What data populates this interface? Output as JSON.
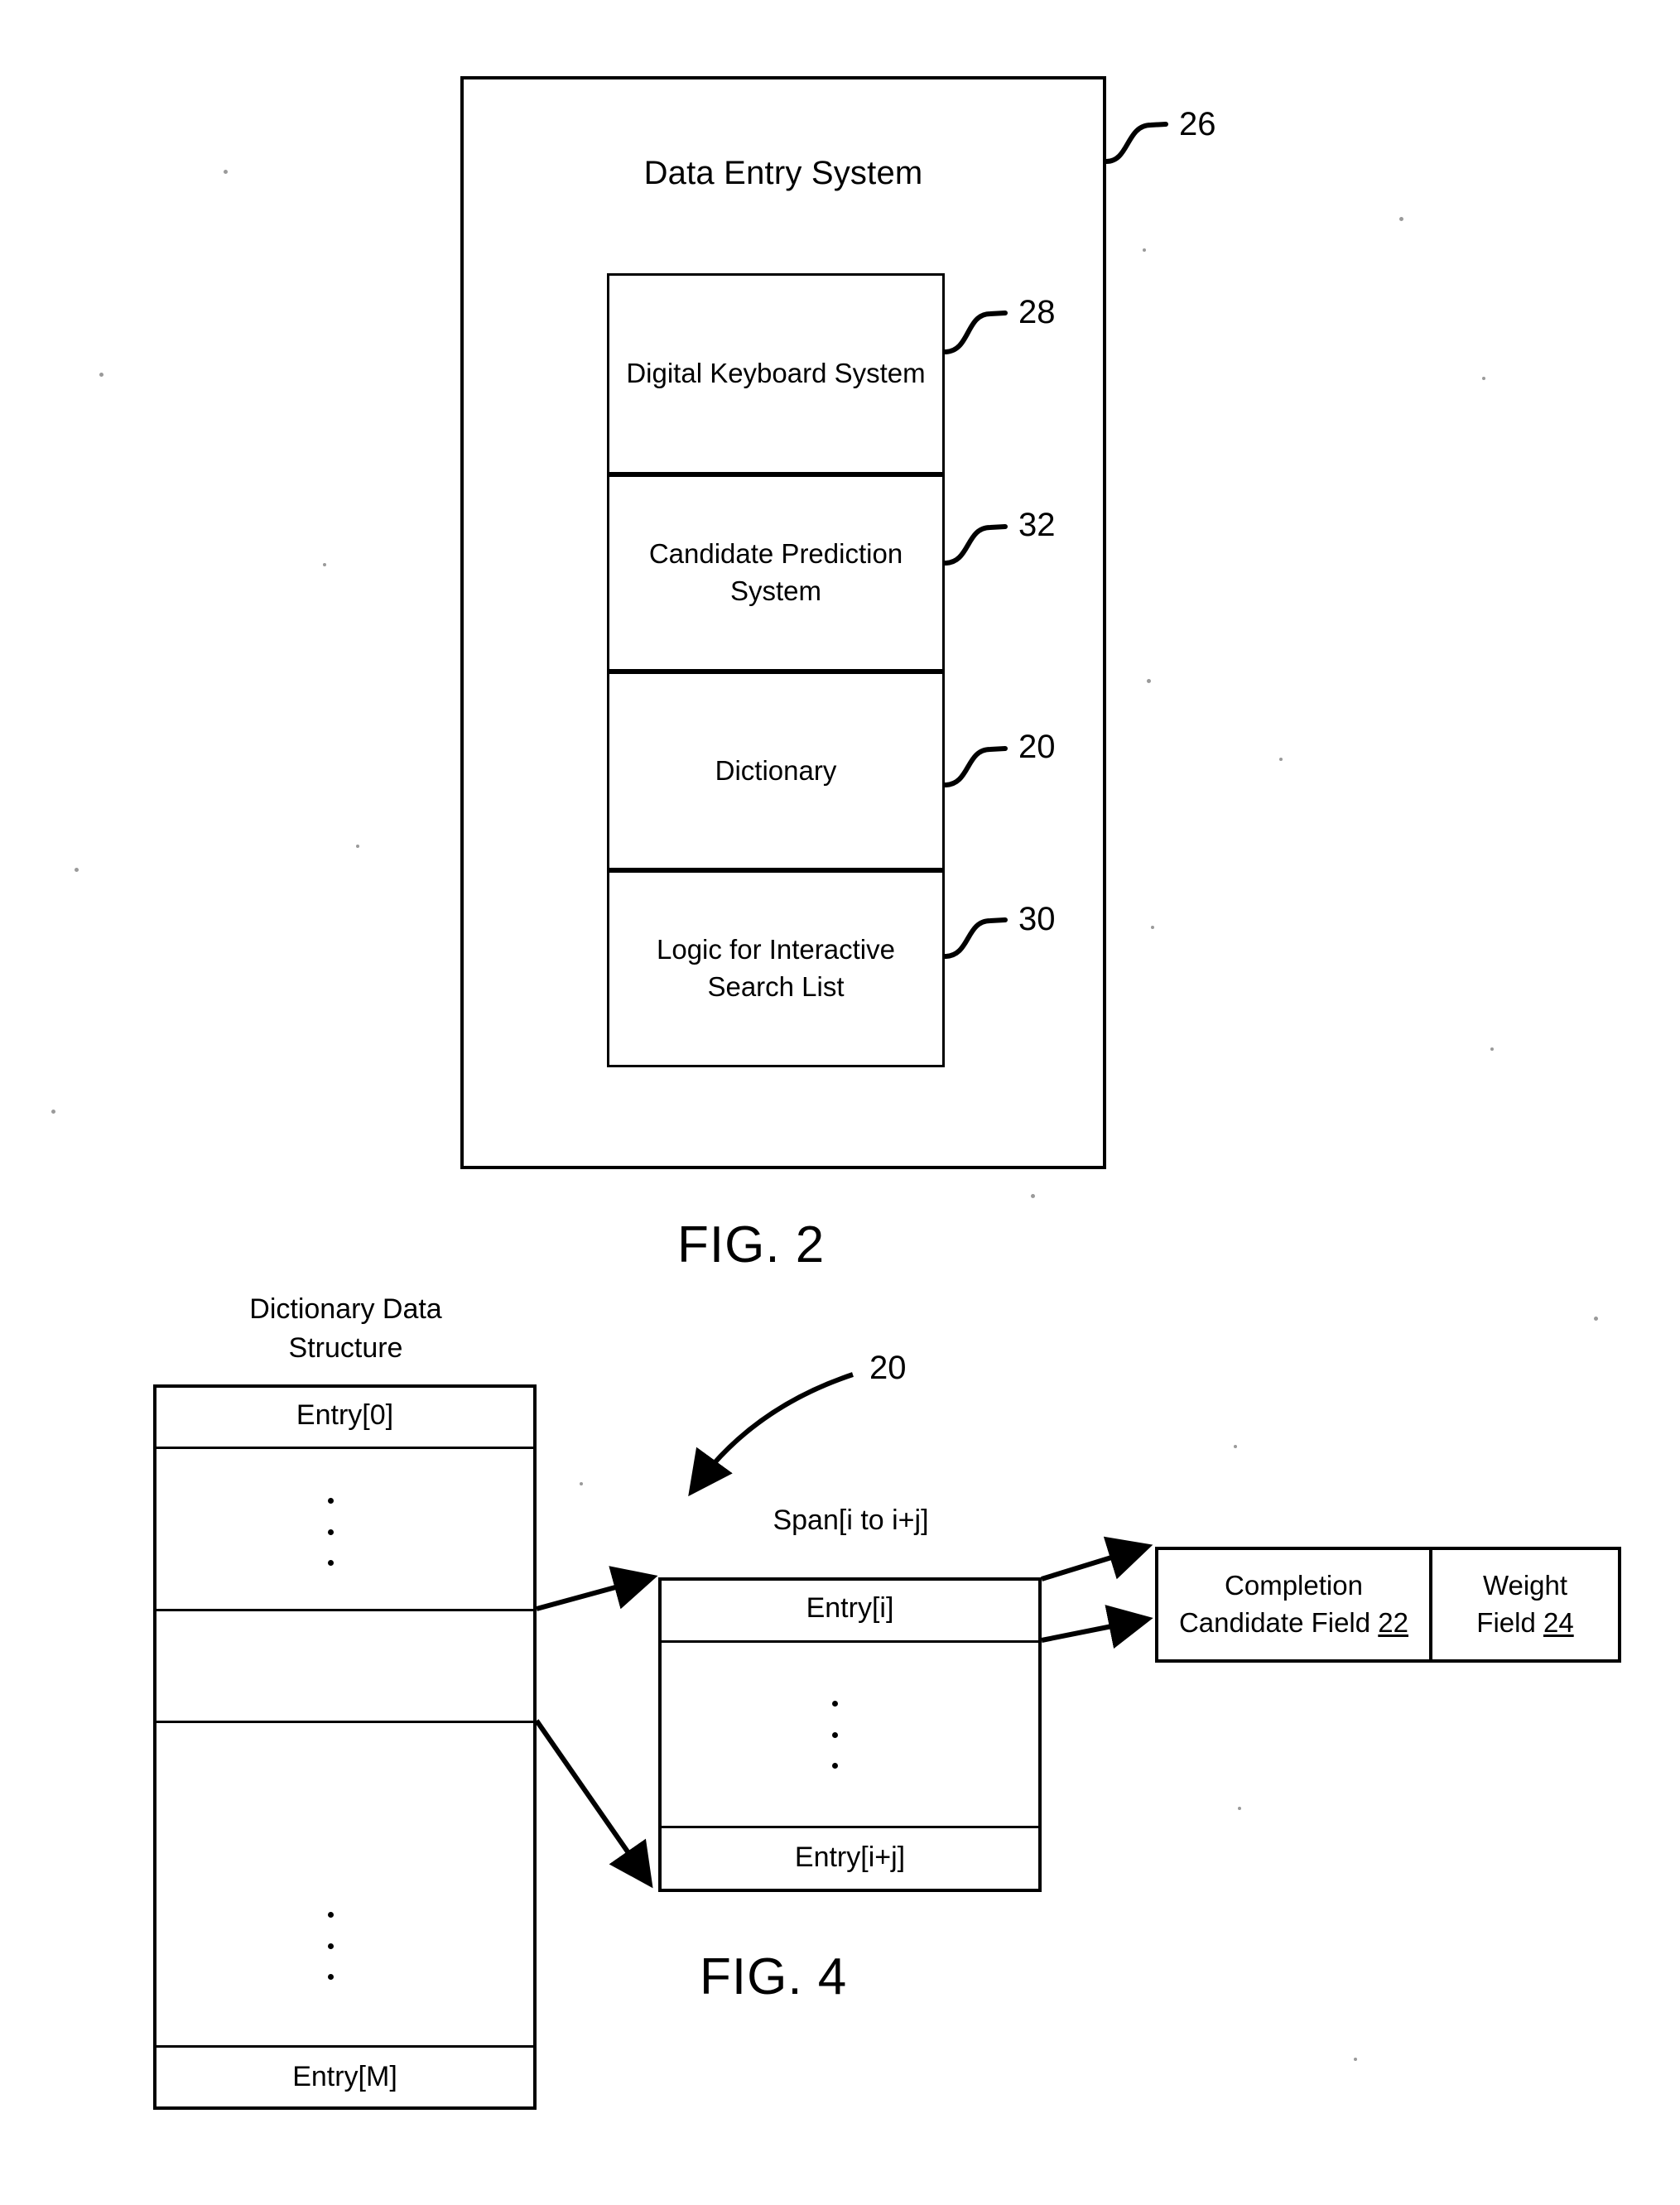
{
  "figures": [
    {
      "id": "fig2",
      "caption": "FIG. 2",
      "outer_box": {
        "title": "Data Entry System",
        "ref": "26"
      },
      "components": [
        {
          "label": "Digital Keyboard System",
          "ref": "28"
        },
        {
          "label": "Candidate Prediction System",
          "ref": "32"
        },
        {
          "label": "Dictionary",
          "ref": "20"
        },
        {
          "label": "Logic for Interactive Search List",
          "ref": "30"
        }
      ]
    },
    {
      "id": "fig4",
      "caption": "FIG. 4",
      "ref": "20",
      "dictionary_table": {
        "title": "Dictionary Data Structure",
        "first_row": "Entry[0]",
        "last_row": "Entry[M]",
        "ellipsis": "vertical-dots"
      },
      "span_table": {
        "title": "Span[i to i+j]",
        "first_row": "Entry[i]",
        "last_row": "Entry[i+j]",
        "ellipsis": "vertical-dots"
      },
      "entry_record": {
        "fields": [
          {
            "name": "Completion Candidate Field",
            "ref": "22"
          },
          {
            "name": "Weight Field",
            "ref": "24"
          }
        ]
      }
    }
  ],
  "fig2": {
    "caption": "FIG. 2",
    "title": "Data Entry System",
    "ref_outer": "26",
    "c0_label": "Digital Keyboard System",
    "c0_ref": "28",
    "c1_label_line1": "Candidate Prediction",
    "c1_label_line2": "System",
    "c1_ref": "32",
    "c2_label": "Dictionary",
    "c2_ref": "20",
    "c3_label_line1": "Logic for Interactive",
    "c3_label_line2": "Search List",
    "c3_ref": "30"
  },
  "fig4": {
    "caption": "FIG. 4",
    "ref": "20",
    "dict_title_line1": "Dictionary Data",
    "dict_title_line2": "Structure",
    "entry_0": "Entry[0]",
    "entry_M": "Entry[M]",
    "span_title": "Span[i to i+j]",
    "entry_i": "Entry[i]",
    "entry_ij": "Entry[i+j]",
    "completion_line1": "Completion",
    "completion_line2": "Candidate Field ",
    "completion_ref": "22",
    "weight_line1": "Weight",
    "weight_line2": "Field ",
    "weight_ref": "24"
  },
  "colors": {
    "ink": "#000000",
    "paper": "#ffffff"
  }
}
